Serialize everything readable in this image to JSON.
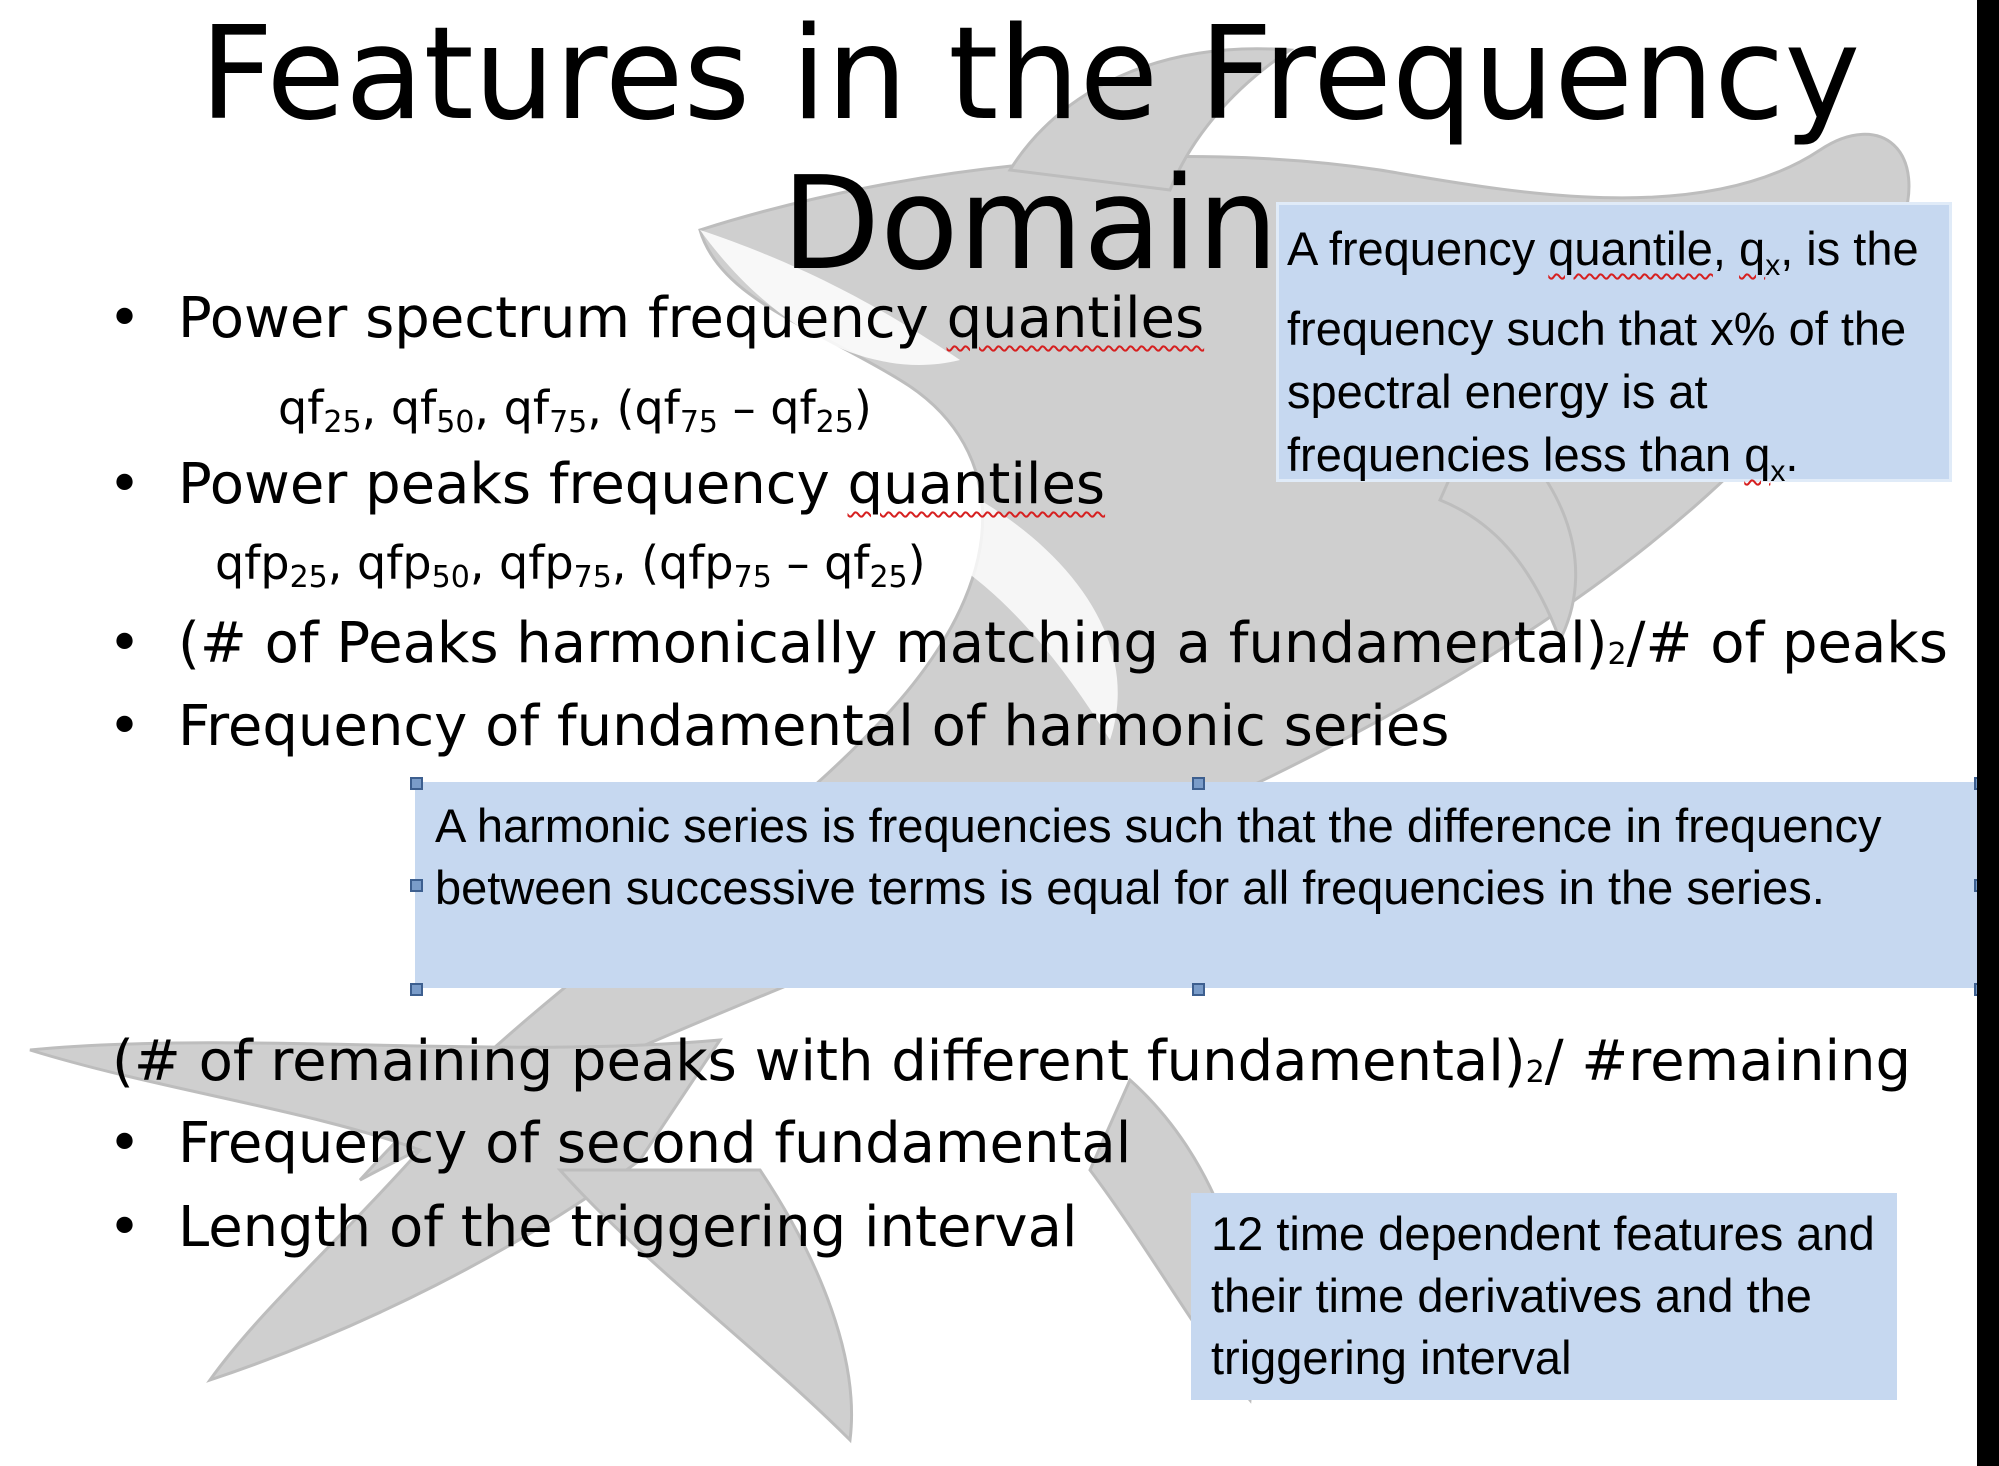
{
  "slide": {
    "title_line1": "Features in the Frequency",
    "title_line2": "Domain",
    "bullet_glyph": "•",
    "bullets": {
      "power_spectrum": {
        "text": "Power spectrum frequency ",
        "flagged_word": "quantiles"
      },
      "power_spectrum_sub": {
        "p1": "qf",
        "s1": "25",
        "p2": ", qf",
        "s2": "50",
        "p3": ", qf",
        "s3": "75",
        "p4": ", (qf",
        "s4": "75",
        "p5": " – qf",
        "s5": "25",
        "p6": ")"
      },
      "power_peaks": {
        "text": "Power peaks frequency ",
        "flagged_word": "quantiles"
      },
      "power_peaks_sub": {
        "p1": "qfp",
        "s1": "25",
        "p2": ", qfp",
        "s2": "50",
        "p3": ", qfp",
        "s3": "75",
        "p4": ", (qfp",
        "s4": "75",
        "p5": " – qf",
        "s5": "25",
        "p6": ")"
      },
      "harmonic_ratio": {
        "before": "(# of Peaks harmonically matching a fundamental)",
        "exp": "2",
        "after": "/# of peaks"
      },
      "fundamental_freq": "Frequency of fundamental of harmonic series",
      "remaining_ratio": {
        "before": "(# of remaining peaks with different fundamental)",
        "exp": "2",
        "after": "/ #remaining"
      },
      "second_fundamental": "Frequency of second fundamental",
      "triggering_length": "Length of the triggering interval"
    },
    "callouts": {
      "quantile_def": {
        "p1": "A frequency ",
        "w1": "quantile",
        "p2": ", ",
        "w2": "q",
        "s2": "x",
        "p3": ", is the frequency such that x% of the spectral energy is at frequencies less than ",
        "w3": "q",
        "s3": "x",
        "p4": "."
      },
      "harmonic_def": "A harmonic series is frequencies such that the difference in frequency between successive terms is equal for all frequencies in the series.",
      "summary": "12 time dependent features and their time derivatives and the triggering interval"
    },
    "colors": {
      "callout_fill": "#c6d8f0",
      "spellcheck": "#d62020",
      "watermark": "#cfcfcf",
      "handle": "#7a9cc9"
    },
    "icons": {
      "background": "orca-whale-watermark"
    }
  }
}
